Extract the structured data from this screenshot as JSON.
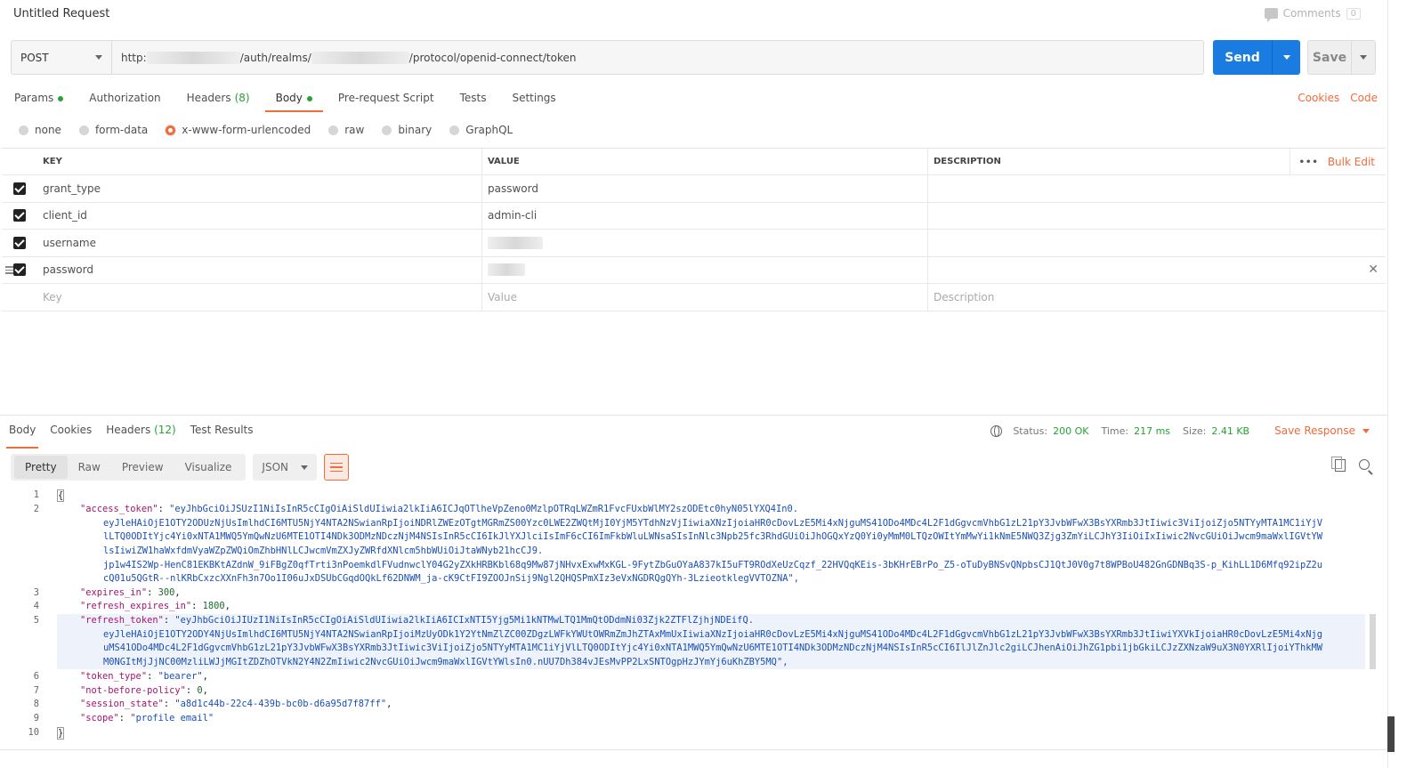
{
  "title": "Untitled Request",
  "comments": {
    "label": "Comments",
    "count": "0"
  },
  "request": {
    "method": "POST",
    "url_prefix": "http:",
    "url_middle": "/auth/realms/",
    "url_suffix": "/protocol/openid-connect/token",
    "send_label": "Send",
    "save_label": "Save"
  },
  "req_tabs": [
    {
      "label": "Params",
      "count": "",
      "dot": true
    },
    {
      "label": "Authorization",
      "count": "",
      "dot": false
    },
    {
      "label": "Headers",
      "count": "(8)",
      "dot": false
    },
    {
      "label": "Body",
      "count": "",
      "dot": true
    },
    {
      "label": "Pre-request Script",
      "count": "",
      "dot": false
    },
    {
      "label": "Tests",
      "count": "",
      "dot": false
    },
    {
      "label": "Settings",
      "count": "",
      "dot": false
    }
  ],
  "links": {
    "cookies": "Cookies",
    "code": "Code"
  },
  "body_types": [
    "none",
    "form-data",
    "x-www-form-urlencoded",
    "raw",
    "binary",
    "GraphQL"
  ],
  "table": {
    "headers": {
      "key": "KEY",
      "value": "VALUE",
      "description": "DESCRIPTION"
    },
    "bulk_edit": "Bulk Edit",
    "more": "•••",
    "rows": [
      {
        "key": "grant_type",
        "value": "password"
      },
      {
        "key": "client_id",
        "value": "admin-cli"
      },
      {
        "key": "username",
        "value": ""
      },
      {
        "key": "password",
        "value": ""
      }
    ],
    "placeholders": {
      "key": "Key",
      "value": "Value",
      "description": "Description"
    }
  },
  "resp_tabs": [
    {
      "label": "Body",
      "count": ""
    },
    {
      "label": "Cookies",
      "count": ""
    },
    {
      "label": "Headers",
      "count": "(12)"
    },
    {
      "label": "Test Results",
      "count": ""
    }
  ],
  "status": {
    "status_label": "Status:",
    "status_value": "200 OK",
    "time_label": "Time:",
    "time_value": "217 ms",
    "size_label": "Size:",
    "size_value": "2.41 KB",
    "save_response": "Save Response"
  },
  "view_modes": [
    "Pretty",
    "Raw",
    "Preview",
    "Visualize"
  ],
  "format": "JSON",
  "code": {
    "line_numbers": [
      "1",
      "2",
      "3",
      "4",
      "5",
      "6",
      "7",
      "8",
      "9",
      "10"
    ],
    "open": "{",
    "close": "}",
    "access_token_key": "\"access_token\"",
    "access_token_l1": "\"eyJhbGciOiJSUzI1NiIsInR5cCIgOiAiSldUIiwia2lkIiA6ICJqOTlheVpZeno0MzlpOTRqLWZmR1FvcFUxbWlMY2szODEtc0hyN05lYXQ4In0.",
    "access_token_l2": "eyJleHAiOjE1OTY2ODUzNjUsImlhdCI6MTU5NjY4NTA2NSwianRpIjoiNDRlZWEzOTgtMGRmZS00Yzc0LWE2ZWQtMjI0YjM5YTdhNzVjIiwiaXNzIjoiaHR0cDovLzE5Mi4xNjguMS41ODo4MDc4L2F1dGgvcmVhbG1zL21pY3JvbWFwX3BsYXRmb3JtIiwic3ViIjoiZjo5NTYyMTA1MC1iYjV",
    "access_token_l3": "lLTQ0ODItYjc4Yi0xNTA1MWQ5YmQwNzU6MTE1OTI4NDk3ODMzNDczNjM4NSIsInR5cCI6IkJlYXJlciIsImF6cCI6ImFkbWluLWNsaSIsInNlc3Npb25fc3RhdGUiOiJhOGQxYzQ0Yi0yMmM0LTQzOWItYmMwYi1kNmE5NWQ3Zjg3ZmYiLCJhY3IiOiIxIiwic2NvcGUiOiJwcm9maWxlIGVtYW",
    "access_token_l4": "lsIiwiZW1haWxfdmVyaWZpZWQiOmZhbHNlLCJwcmVmZXJyZWRfdXNlcm5hbWUiOiJtaWNyb21hcCJ9.",
    "access_token_l5": "jp1w4IS2Wp-HenC81EKBKtAZdnW_9iFBgZ0qfTrti3nPoemkdlFVudnwclY04G2yZXkHRBKbl68q9Mw87jNHvxExwMxKGL-9FytZbGuOYaA837kI5uFT9ROdXeUzCqzf_22HVQqKEis-3bKHrEBrPo_Z5-oTuDyBNSvQNpbsCJ1QtJ0V0g7t8WPBoU482GnGDNBq3S-p_KihLL1D6Mfq92ipZ2u",
    "access_token_l6": "cQ01u5QGtR--nlKRbCxzcXXnFh3n7Oo1I06uJxDSUbCGqdOQkLf62DNWM_ja-cK9CtFI9ZOOJnSij9Ngl2QHQSPmXIz3eVxNGDRQgQYh-3LzieotklegVVTOZNA\",",
    "expires_in_key": "\"expires_in\"",
    "expires_in_val": "300",
    "refresh_expires_in_key": "\"refresh_expires_in\"",
    "refresh_expires_in_val": "1800",
    "refresh_token_key": "\"refresh_token\"",
    "refresh_token_l1": "\"eyJhbGciOiJIUzI1NiIsInR5cCIgOiAiSldUIiwia2lkIiA6ICIxNTI5Yjg5Mi1kNTMwLTQ1MmQtODdmNi03Zjk2ZTFlZjhjNDEifQ.",
    "refresh_token_l2": "eyJleHAiOjE1OTY2ODY4NjUsImlhdCI6MTU5NjY4NTA2NSwianRpIjoiMzUyODk1Y2YtNmZlZC00ZDgzLWFkYWUtOWRmZmJhZTAxMmUxIiwiaXNzIjoiaHR0cDovLzE5Mi4xNjguMS41ODo4MDc4L2F1dGgvcmVhbG1zL21pY3JvbWFwX3BsYXRmb3JtIiwiYXVkIjoiaHR0cDovLzE5Mi4xNjg",
    "refresh_token_l3": "uMS41ODo4MDc4L2F1dGgvcmVhbG1zL21pY3JvbWFwX3BsYXRmb3JtIiwic3ViIjoiZjo5NTYyMTA1MC1iYjVlLTQ0ODItYjc4Yi0xNTA1MWQ5YmQwNzU6MTE1OTI4NDk3ODMzNDczNjM4NSIsInR5cCI6IlJlZnJlc2giLCJhenAiOiJhZG1pbi1jbGkiLCJzZXNzaW9uX3N0YXRlIjoiYThkMW",
    "refresh_token_l4": "M0NGItMjJjNC00MzliLWJjMGItZDZhOTVkN2Y4N2ZmIiwic2NvcGUiOiJwcm9maWxlIGVtYWlsIn0.nUU7Dh384vJEsMvPP2LxSNTOgpHzJYmYj6uKhZBY5MQ\",",
    "token_type_key": "\"token_type\"",
    "token_type_val": "\"bearer\"",
    "nbp_key": "\"not-before-policy\"",
    "nbp_val": "0",
    "session_state_key": "\"session_state\"",
    "session_state_val": "\"a8d1c44b-22c4-439b-bc0b-d6a95d7f87ff\"",
    "scope_key": "\"scope\"",
    "scope_val": "\"profile email\""
  }
}
